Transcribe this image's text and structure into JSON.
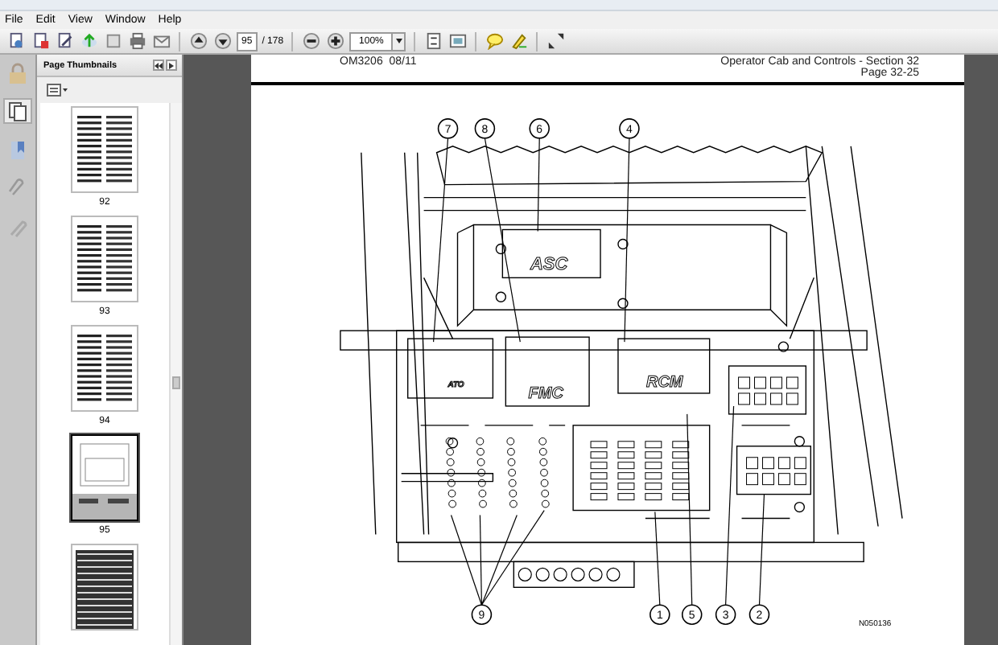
{
  "menu": [
    "File",
    "Edit",
    "View",
    "Window",
    "Help"
  ],
  "toolbar": {
    "page_number": "95",
    "page_count": "/ 178",
    "zoom": "100%"
  },
  "sidebar": {
    "title": "Page Thumbnails",
    "thumbnails": [
      {
        "label": "92",
        "selected": false,
        "kind": "text"
      },
      {
        "label": "93",
        "selected": false,
        "kind": "text"
      },
      {
        "label": "94",
        "selected": false,
        "kind": "text"
      },
      {
        "label": "95",
        "selected": true,
        "kind": "figure"
      },
      {
        "selected": false,
        "kind": "table"
      }
    ]
  },
  "document": {
    "header_left": "OM3206  08/11",
    "header_right": [
      "Operator Cab and Controls - Section 32",
      "Page 32-25"
    ],
    "figure": {
      "panel_labels": [
        "ASC",
        "ATO",
        "FMC",
        "RCM"
      ],
      "top_callouts": [
        "7",
        "8",
        "6",
        "4"
      ],
      "bottom_callouts": [
        "9",
        "1",
        "5",
        "3",
        "2"
      ],
      "figure_id": "N050136"
    }
  }
}
